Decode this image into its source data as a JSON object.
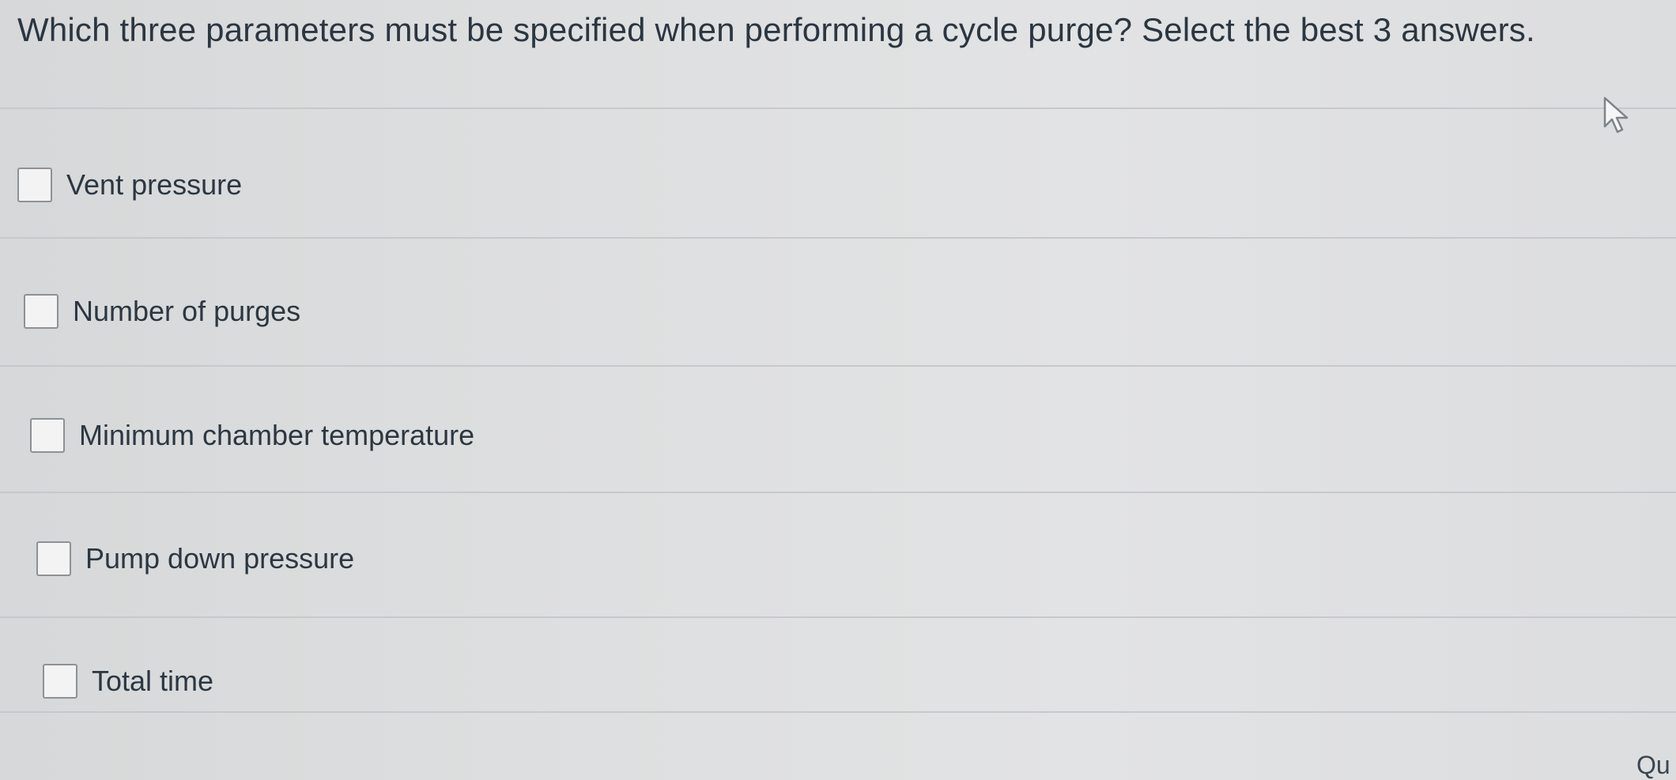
{
  "question": {
    "text": "Which three parameters must be specified when performing a cycle purge? Select the best 3 answers."
  },
  "options": [
    {
      "label": "Vent pressure",
      "checked": false
    },
    {
      "label": "Number of purges",
      "checked": false
    },
    {
      "label": "Minimum chamber temperature",
      "checked": false
    },
    {
      "label": "Pump down pressure",
      "checked": false
    },
    {
      "label": "Total time",
      "checked": false
    }
  ],
  "footer": {
    "partial_text": "Qu"
  },
  "icons": {
    "cursor": "mouse-pointer-icon",
    "checkbox": "checkbox-unchecked"
  },
  "colors": {
    "text": "#2c3742",
    "checkbox_border": "#8d9296",
    "divider": "#c6c9cc"
  }
}
